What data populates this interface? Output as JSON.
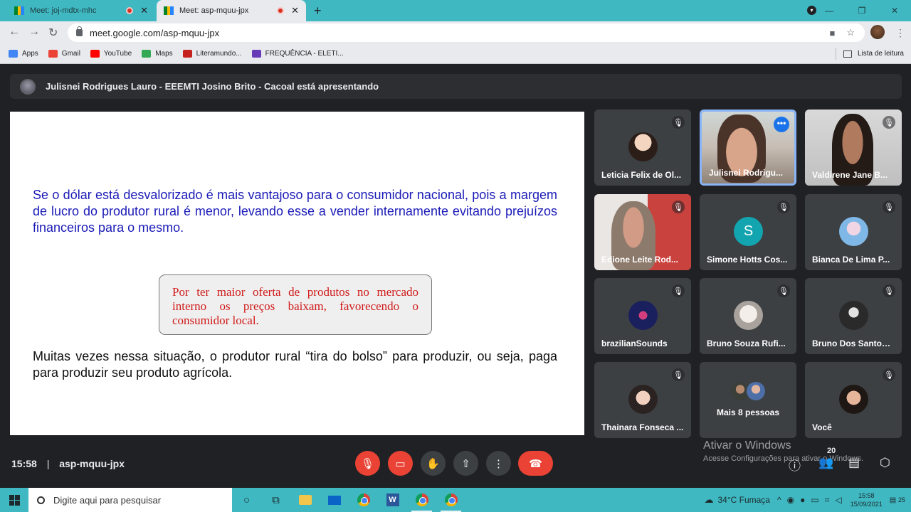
{
  "browser": {
    "tabs": [
      {
        "title": "Meet: joj-mdtx-mhc",
        "recording": true
      },
      {
        "title": "Meet: asp-mquu-jpx",
        "recording": true
      }
    ],
    "url": "meet.google.com/asp-mquu-jpx",
    "bookmarks": [
      {
        "label": "Apps",
        "icon": "apps-grid-icon",
        "color": "#4285f4"
      },
      {
        "label": "Gmail",
        "icon": "gmail-icon",
        "color": "#ea4335"
      },
      {
        "label": "YouTube",
        "icon": "youtube-icon",
        "color": "#ff0000"
      },
      {
        "label": "Maps",
        "icon": "maps-icon",
        "color": "#34a853"
      },
      {
        "label": "Literamundo...",
        "icon": "literamundo-icon",
        "color": "#c5221f"
      },
      {
        "label": "FREQUÊNCIA - ELETI...",
        "icon": "forms-icon",
        "color": "#673ab7"
      }
    ],
    "reading_list": "Lista de leitura"
  },
  "meet": {
    "presenting_banner": "Julisnei Rodrigues Lauro - EEEMTI Josino Brito - Cacoal está apresentando",
    "slide": {
      "paragraph1": "Se o dólar está desvalorizado é mais vantajoso para o consumidor nacional, pois a margem de lucro do produtor rural é menor, levando esse a vender internamente evitando prejuízos financeiros para o mesmo.",
      "callout": "Por ter maior oferta de produtos no mercado interno os preços baixam, favorecendo o consumidor local.",
      "paragraph2": "Muitas vezes nessa situação, o produtor rural “tira do bolso” para produzir, ou seja, paga para produzir seu produto agrícola."
    },
    "participants": [
      {
        "name": "Leticia Felix de Ol...",
        "muted": true
      },
      {
        "name": "Julisnei Rodrigu...",
        "muted": false,
        "speaking": true
      },
      {
        "name": "Valdirene Jane B...",
        "muted": true
      },
      {
        "name": "Edione Leite Rod...",
        "muted": true
      },
      {
        "name": "Simone Hotts Cos...",
        "muted": true,
        "initial": "S"
      },
      {
        "name": "Bianca De Lima P...",
        "muted": true
      },
      {
        "name": "brazilianSounds",
        "muted": true
      },
      {
        "name": "Bruno Souza Rufi...",
        "muted": true
      },
      {
        "name": "Bruno Dos Santos ...",
        "muted": true
      },
      {
        "name": "Thainara Fonseca ...",
        "muted": true
      },
      {
        "name": "Mais 8 pessoas"
      },
      {
        "name": "Você",
        "muted": true
      }
    ],
    "time": "15:58",
    "separator": "|",
    "meeting_code": "asp-mquu-jpx",
    "people_count": "20",
    "colors": {
      "end_call": "#ea4335",
      "accent": "#1a73e8",
      "background": "#202124"
    }
  },
  "windows": {
    "activate_title": "Ativar o Windows",
    "activate_sub": "Acesse Configurações para ativar o Windows.",
    "search_placeholder": "Digite aqui para pesquisar",
    "weather": "34°C Fumaça",
    "clock_time": "15:58",
    "clock_date": "15/09/2021",
    "notif_count": "25"
  }
}
